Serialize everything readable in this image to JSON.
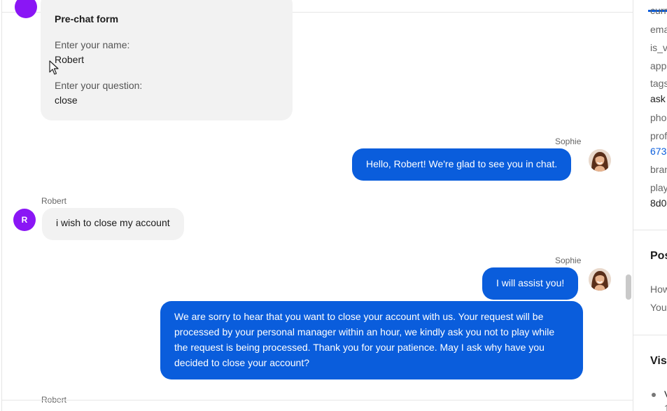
{
  "prechat_form": {
    "title": "Pre-chat form",
    "name_label": "Enter your name:",
    "name_value": "Robert",
    "question_label": "Enter your question:",
    "question_value": "close"
  },
  "messages": [
    {
      "sender": "Sophie",
      "text": "Hello, Robert! We're glad to see you in chat."
    },
    {
      "sender": "Robert",
      "avatar_initial": "R",
      "text": "i wish to close my account"
    },
    {
      "sender": "Sophie",
      "text": "I will assist you!"
    },
    {
      "text": "We are sorry to hear that you want to close your account with us. Your request will be processed by your personal manager within an hour, we kindly ask you not to play while the request is being processed. Thank you for your patience. May I ask why have you decided to close your account?"
    },
    {
      "sender": "Robert"
    }
  ],
  "sidebar": {
    "fields": [
      "curr",
      "ema",
      "is_v",
      "app",
      "tags",
      "ask",
      "pho",
      "prof",
      "673",
      "bran",
      "play",
      "8d0"
    ],
    "section2_title": "Pos",
    "section2_lines": [
      "How",
      "You"
    ],
    "section3_title": "Vis",
    "section3_items": [
      "V",
      "1"
    ]
  },
  "colors": {
    "accent": "#0a5ddc",
    "avatar": "#8a16f5",
    "bubble_in": "#f2f2f2"
  },
  "icons": [
    "agent-avatar-icon",
    "cursor-icon"
  ]
}
